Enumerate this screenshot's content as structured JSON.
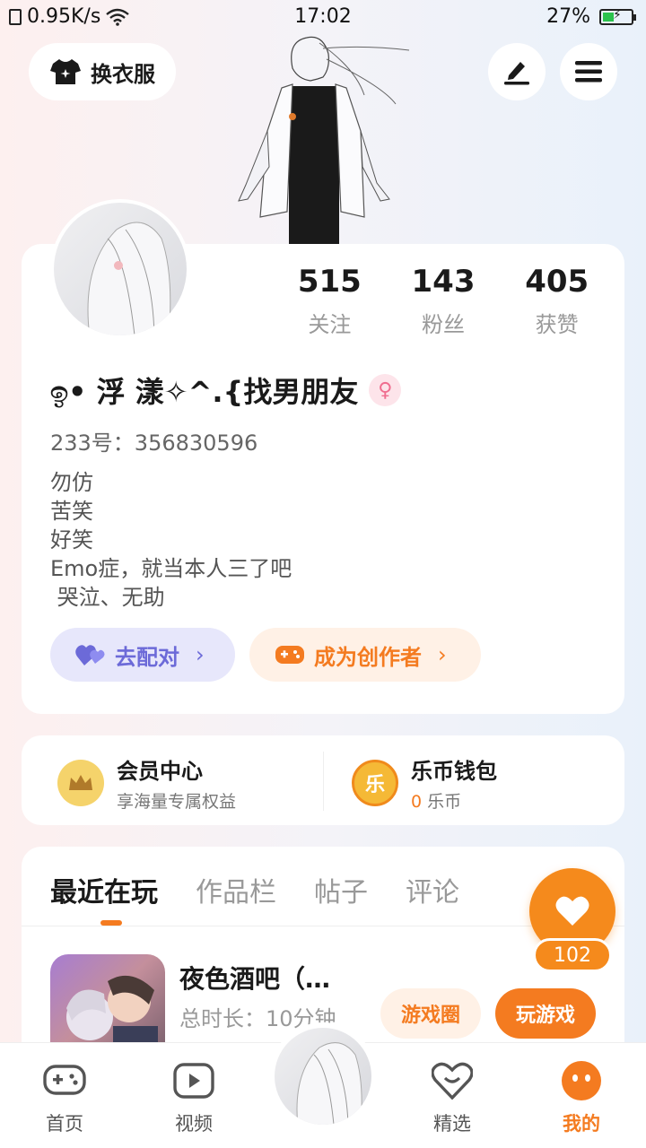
{
  "status_bar": {
    "net_speed": "0.95K/s",
    "time": "17:02",
    "battery": "27%"
  },
  "header": {
    "outfit_label": "换衣服"
  },
  "profile": {
    "stats": [
      {
        "num": "515",
        "label": "关注"
      },
      {
        "num": "143",
        "label": "粉丝"
      },
      {
        "num": "405",
        "label": "获赞"
      }
    ],
    "nickname": "ඉ• 浮  漾✧^.{找男朋友",
    "gender_symbol": "♀",
    "uid": "233号：356830596",
    "bio": [
      "勿仿",
      "苦笑",
      "好笑",
      "Emo症，就当本人三了吧",
      " 哭泣、无助"
    ],
    "match_label": "去配对",
    "creator_label": "成为创作者",
    "chevron": "›"
  },
  "info": {
    "member_title": "会员中心",
    "member_sub": "享海量专属权益",
    "wallet_title": "乐币钱包",
    "wallet_icon_text": "乐",
    "wallet_count": "0",
    "wallet_unit": "乐币"
  },
  "tabs": [
    "最近在玩",
    "作品栏",
    "帖子",
    "评论"
  ],
  "recent_game": {
    "name": "夜色酒吧（…",
    "time": "总时长：10分钟",
    "circle_label": "游戏圈",
    "play_label": "玩游戏"
  },
  "like": {
    "count": "102"
  },
  "nav": {
    "home": "首页",
    "video": "视频",
    "featured": "精选",
    "mine": "我的"
  },
  "colors": {
    "accent": "#f47b20",
    "match": "#6c6ad8",
    "gold": "#f5b936"
  }
}
